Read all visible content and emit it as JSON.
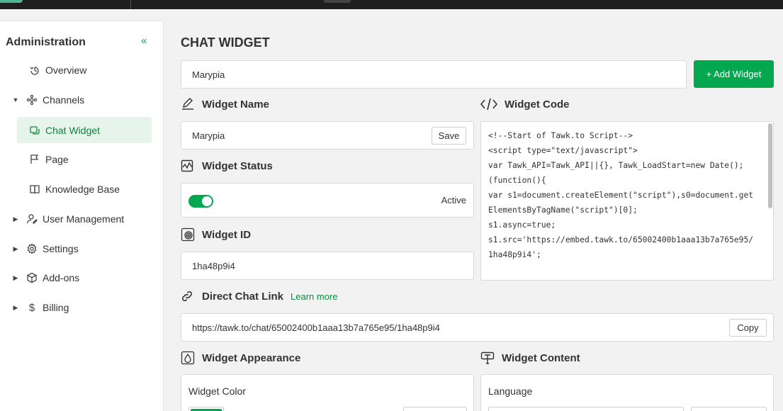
{
  "sidebar": {
    "title": "Administration",
    "items": [
      {
        "label": "Overview",
        "icon": "overview-icon"
      },
      {
        "label": "Channels",
        "icon": "channels-icon"
      },
      {
        "label": "Chat Widget",
        "icon": "chat-widget-icon",
        "active": true
      },
      {
        "label": "Page",
        "icon": "page-flag-icon"
      },
      {
        "label": "Knowledge Base",
        "icon": "book-icon"
      },
      {
        "label": "User Management",
        "icon": "user-management-icon"
      },
      {
        "label": "Settings",
        "icon": "gear-icon"
      },
      {
        "label": "Add-ons",
        "icon": "box-icon"
      },
      {
        "label": "Billing",
        "icon": "dollar-icon"
      }
    ]
  },
  "main": {
    "title": "CHAT WIDGET",
    "widget_select": "Marypia",
    "add_widget_label": "+ Add Widget",
    "widget_name": {
      "heading": "Widget Name",
      "value": "Marypia",
      "save_label": "Save"
    },
    "widget_status": {
      "heading": "Widget Status",
      "status": "Active",
      "enabled": true
    },
    "widget_id": {
      "heading": "Widget ID",
      "value": "1ha48p9i4"
    },
    "widget_code": {
      "heading": "Widget Code",
      "code": "<!--Start of Tawk.to Script-->\n<script type=\"text/javascript\">\nvar Tawk_API=Tawk_API||{}, Tawk_LoadStart=new Date();\n(function(){\nvar s1=document.createElement(\"script\"),s0=document.getElementsByTagName(\"script\")[0];\ns1.async=true;\ns1.src='https://embed.tawk.to/65002400b1aaa13b7a765e95/1ha48p9i4';"
    },
    "direct_chat_link": {
      "heading": "Direct Chat Link",
      "learn_more": "Learn more",
      "url": "https://tawk.to/chat/65002400b1aaa13b7a765e95/1ha48p9i4",
      "copy_label": "Copy"
    },
    "widget_appearance": {
      "heading": "Widget Appearance",
      "widget_color_label": "Widget Color"
    },
    "widget_content": {
      "heading": "Widget Content",
      "language_label": "Language"
    }
  },
  "colors": {
    "brand_green": "#03a84e",
    "active_bg": "#e6f4ec"
  }
}
